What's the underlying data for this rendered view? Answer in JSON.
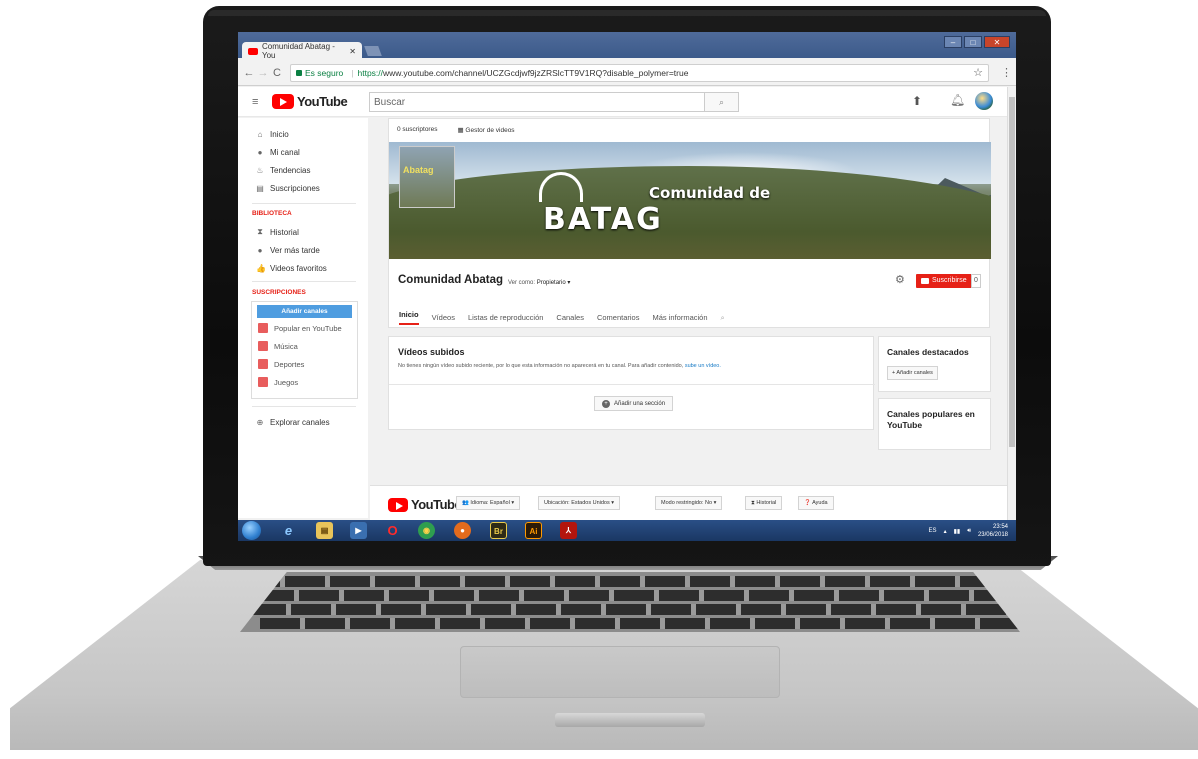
{
  "browser": {
    "tab_title": "Comunidad Abatag - You",
    "tab_close": "✕",
    "url_secure": "Es seguro",
    "url_https": "https://",
    "url_rest": "www.youtube.com/channel/UCZGcdjwf9jzZRSlcTT9V1RQ?disable_polymer=true",
    "star": "☆",
    "menu": "⋮",
    "back": "←",
    "forward": "→",
    "reload": "C"
  },
  "masthead": {
    "logo": "YouTube",
    "search_placeholder": "Buscar",
    "search_icon": "🔍"
  },
  "sidebar": {
    "items": [
      {
        "label": "Inicio",
        "icon": "⌂"
      },
      {
        "label": "Mi canal",
        "icon": "●"
      },
      {
        "label": "Tendencias",
        "icon": "♨"
      },
      {
        "label": "Suscripciones",
        "icon": "▤"
      }
    ],
    "library_heading": "BIBLIOTECA",
    "library_items": [
      {
        "label": "Historial",
        "icon": "⧗"
      },
      {
        "label": "Ver más tarde",
        "icon": "●"
      },
      {
        "label": "Videos favoritos",
        "icon": "👍"
      }
    ],
    "subs_heading": "SUSCRIPCIONES",
    "add_channels": "Añadir canales",
    "subs_items": [
      {
        "label": "Popular en YouTube",
        "color": "#e85d5d"
      },
      {
        "label": "Música",
        "color": "#e85d5d"
      },
      {
        "label": "Deportes",
        "color": "#e85d5d"
      },
      {
        "label": "Juegos",
        "color": "#e85d5d"
      }
    ],
    "explore": "Explorar canales"
  },
  "channel": {
    "subscribers": "0 suscriptores",
    "video_manager": "Gestor de videos",
    "banner_thumb": "Abatag",
    "banner_line1": "Comunidad de",
    "banner_line2": "BATAG",
    "name": "Comunidad Abatag",
    "view_as_label": "Ver como:",
    "view_as_value": "Propietario ▾",
    "subscribe": "Suscribirse",
    "sub_count": "0",
    "tabs": [
      "Inicio",
      "Vídeos",
      "Listas de reproducción",
      "Canales",
      "Comentarios",
      "Más información"
    ]
  },
  "uploads": {
    "title": "Vídeos subidos",
    "text": "No tienes ningún vídeo subido reciente, por lo que esta información no aparecerá en tu canal. Para añadir contenido,",
    "link": "sube un vídeo.",
    "add_section": "Añadir una sección"
  },
  "featured": {
    "title": "Canales destacados",
    "button": "+ Añadir canales"
  },
  "popular": {
    "title": "Canales populares en YouTube"
  },
  "footer": {
    "logo": "YouTube",
    "language": "Idioma: Español ▾",
    "location_label": "Ubicación:",
    "location_value": "Estados Unidos ▾",
    "restricted": "Modo restringido: No ▾",
    "history": "Historial",
    "help": "Ayuda"
  },
  "taskbar": {
    "lang": "ES",
    "time": "23:54",
    "date": "23/06/2018",
    "apps": [
      {
        "name": "ie",
        "label": "e",
        "color": "#2d8ae0"
      },
      {
        "name": "explorer",
        "label": "▤",
        "color": "#e8c45a"
      },
      {
        "name": "media",
        "label": "▶",
        "color": "#3a6fb0"
      },
      {
        "name": "opera",
        "label": "O",
        "color": "#cc1b1b"
      },
      {
        "name": "chrome",
        "label": "◉",
        "color": "#2e9e4f"
      },
      {
        "name": "firefox",
        "label": "●",
        "color": "#e36b1d"
      },
      {
        "name": "bridge",
        "label": "Br",
        "color": "#2d2a16"
      },
      {
        "name": "illustrator",
        "label": "Ai",
        "color": "#2b1a06"
      },
      {
        "name": "acrobat",
        "label": "⅄",
        "color": "#b3150d"
      }
    ]
  },
  "colors": {
    "yt_red": "#ff0000",
    "subscribe_red": "#e62117",
    "link_blue": "#167ac6",
    "accent_blue": "#4f9de0"
  }
}
